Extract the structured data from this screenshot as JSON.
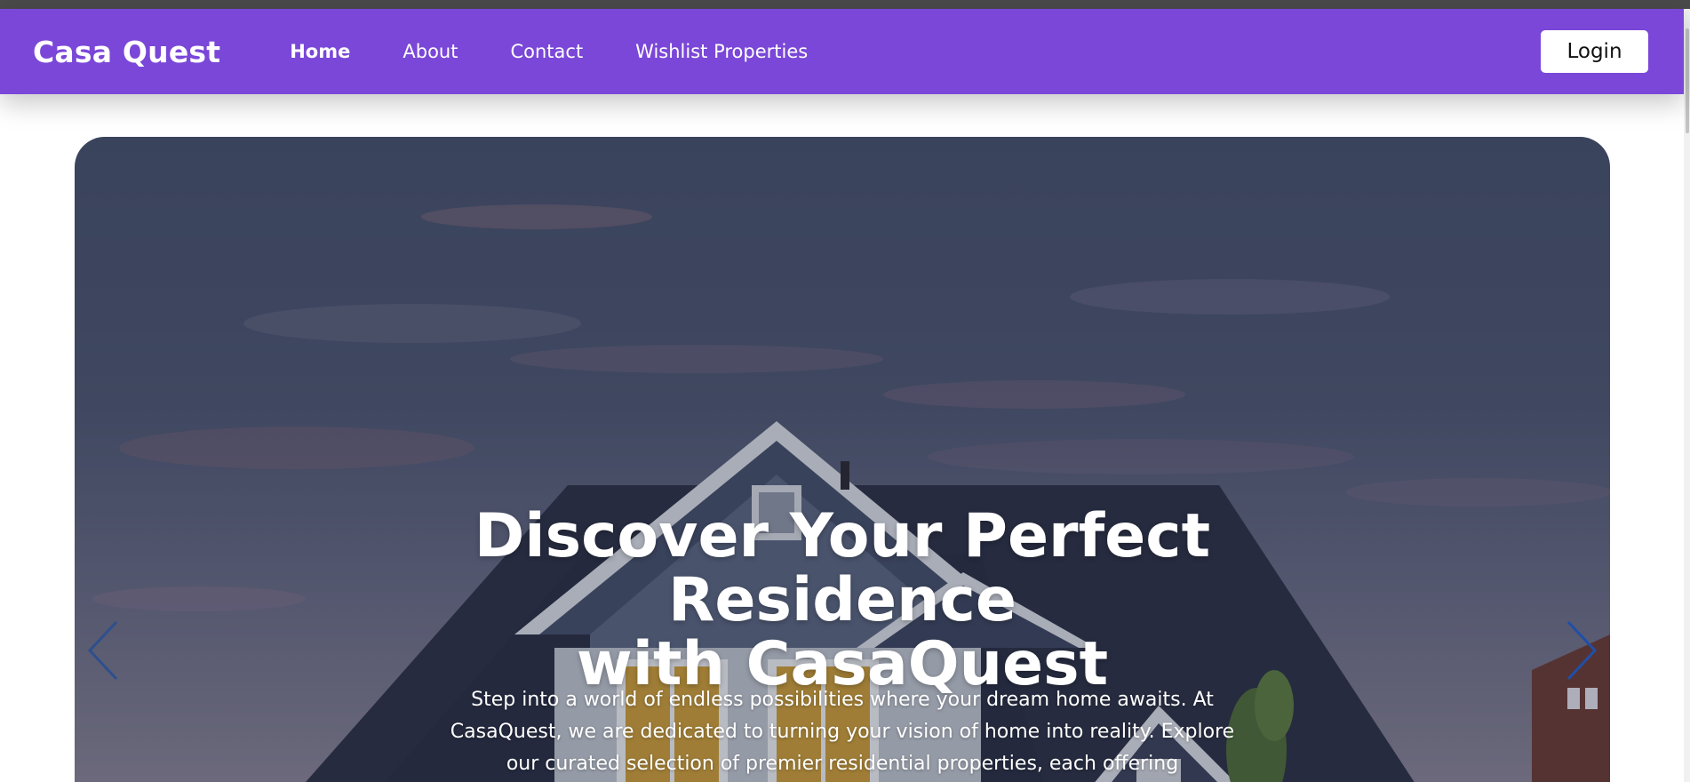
{
  "navbar": {
    "brand": "Casa Quest",
    "links": [
      {
        "label": "Home",
        "active": true
      },
      {
        "label": "About",
        "active": false
      },
      {
        "label": "Contact",
        "active": false
      },
      {
        "label": "Wishlist Properties",
        "active": false
      }
    ],
    "login_label": "Login"
  },
  "hero": {
    "title_line1": "Discover Your Perfect Residence",
    "title_line2": "with CasaQuest",
    "description": "Step into a world of endless possibilities where your dream home awaits. At CasaQuest, we are dedicated to turning your vision of home into reality. Explore our curated selection of premier residential properties, each offering unparalleled",
    "prev_icon": "chevron-left-icon",
    "next_icon": "chevron-right-icon"
  },
  "colors": {
    "navbar_bg": "#7a47d8",
    "arrow_prev": "#2d4f8e",
    "arrow_next": "#1f4fa8"
  }
}
